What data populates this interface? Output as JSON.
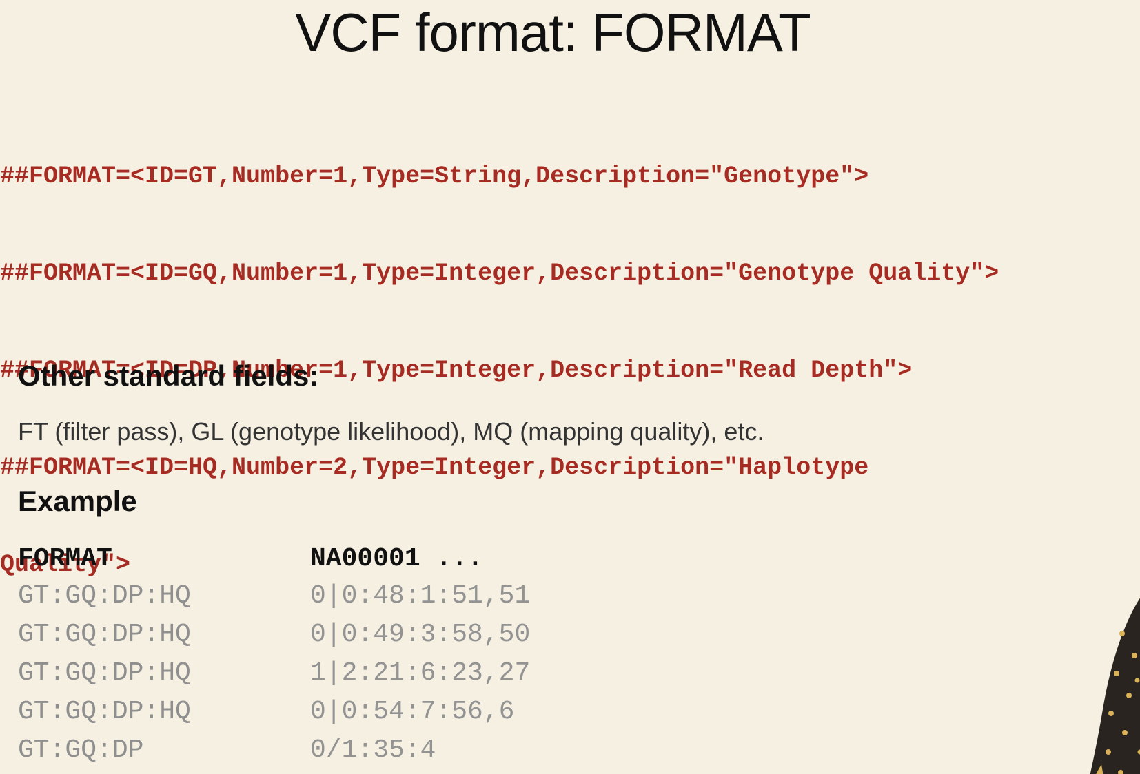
{
  "slide": {
    "title": "VCF format: FORMAT",
    "format_lines": [
      "##FORMAT=<ID=GT,Number=1,Type=String,Description=\"Genotype\">",
      "##FORMAT=<ID=GQ,Number=1,Type=Integer,Description=\"Genotype Quality\">",
      "##FORMAT=<ID=DP,Number=1,Type=Integer,Description=\"Read Depth\">",
      "##FORMAT=<ID=HQ,Number=2,Type=Integer,Description=\"Haplotype",
      "Quality\">"
    ],
    "other_fields": {
      "heading": "Other standard fields:",
      "text": "FT (filter pass), GL (genotype likelihood), MQ (mapping quality), etc."
    },
    "example": {
      "heading": "Example",
      "columns": [
        "FORMAT",
        "NA00001 ..."
      ],
      "rows": [
        [
          "GT:GQ:DP:HQ",
          "0|0:48:1:51,51"
        ],
        [
          "GT:GQ:DP:HQ",
          "0|0:49:3:58,50"
        ],
        [
          "GT:GQ:DP:HQ",
          "1|2:21:6:23,27"
        ],
        [
          "GT:GQ:DP:HQ",
          "0|0:54:7:56,6"
        ],
        [
          "GT:GQ:DP",
          "0/1:35:4"
        ]
      ]
    }
  },
  "colors": {
    "background": "#f6f0e2",
    "code_red": "#a62b22",
    "text_dark": "#111111",
    "example_gray": "#8f8f8f"
  },
  "images": {
    "presenter": "presenter-partial-image"
  }
}
